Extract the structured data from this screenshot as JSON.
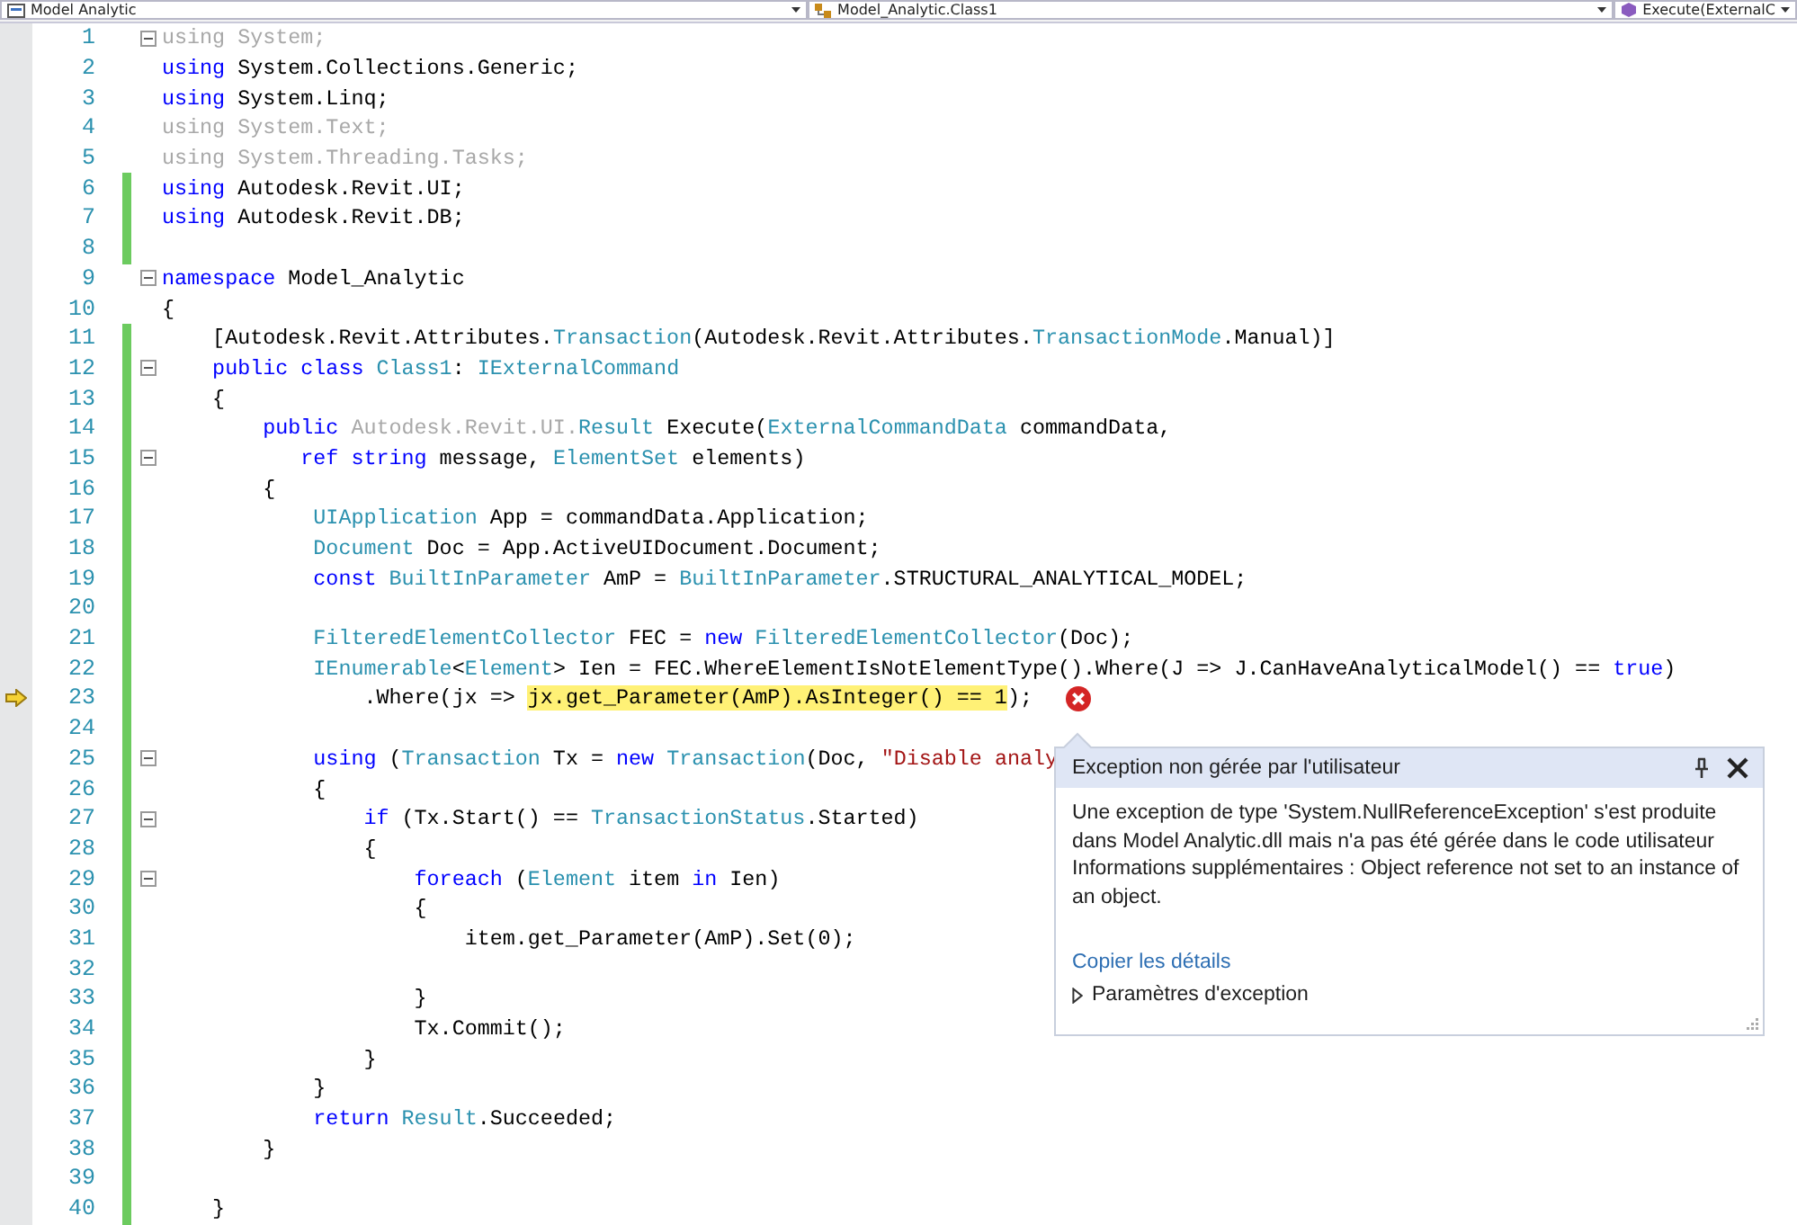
{
  "nav": [
    {
      "kind": "project",
      "label": "Model Analytic"
    },
    {
      "kind": "class",
      "label": "Model_Analytic.Class1"
    },
    {
      "kind": "method",
      "label": "Execute(ExternalC"
    }
  ],
  "lines": [
    {
      "n": "1",
      "changed": false,
      "fold": true,
      "current": false,
      "error": false,
      "tokens": [
        {
          "kind": "faded",
          "text": "using System;"
        }
      ]
    },
    {
      "n": "2",
      "changed": false,
      "fold": false,
      "current": false,
      "error": false,
      "tokens": [
        {
          "kind": "kw",
          "text": "using"
        },
        {
          "kind": "plain",
          "text": " System.Collections.Generic;"
        }
      ]
    },
    {
      "n": "3",
      "changed": false,
      "fold": false,
      "current": false,
      "error": false,
      "tokens": [
        {
          "kind": "kw",
          "text": "using"
        },
        {
          "kind": "plain",
          "text": " System.Linq;"
        }
      ]
    },
    {
      "n": "4",
      "changed": false,
      "fold": false,
      "current": false,
      "error": false,
      "tokens": [
        {
          "kind": "faded",
          "text": "using System.Text;"
        }
      ]
    },
    {
      "n": "5",
      "changed": false,
      "fold": false,
      "current": false,
      "error": false,
      "tokens": [
        {
          "kind": "faded",
          "text": "using System.Threading.Tasks;"
        }
      ]
    },
    {
      "n": "6",
      "changed": true,
      "fold": false,
      "current": false,
      "error": false,
      "tokens": [
        {
          "kind": "kw",
          "text": "using"
        },
        {
          "kind": "plain",
          "text": " Autodesk.Revit.UI;"
        }
      ]
    },
    {
      "n": "7",
      "changed": true,
      "fold": false,
      "current": false,
      "error": false,
      "tokens": [
        {
          "kind": "kw",
          "text": "using"
        },
        {
          "kind": "plain",
          "text": " Autodesk.Revit.DB;"
        }
      ]
    },
    {
      "n": "8",
      "changed": true,
      "fold": false,
      "current": false,
      "error": false
    },
    {
      "n": "9",
      "changed": false,
      "fold": true,
      "current": false,
      "error": false,
      "tokens": [
        {
          "kind": "kw",
          "text": "namespace"
        },
        {
          "kind": "plain",
          "text": " Model_Analytic"
        }
      ]
    },
    {
      "n": "10",
      "changed": false,
      "fold": false,
      "current": false,
      "error": false,
      "tokens": [
        {
          "kind": "plain",
          "text": "{"
        }
      ]
    },
    {
      "n": "11",
      "changed": true,
      "fold": false,
      "current": false,
      "error": false,
      "tokens": [
        {
          "kind": "plain",
          "text": "    [Autodesk.Revit.Attributes."
        },
        {
          "kind": "type",
          "text": "Transaction"
        },
        {
          "kind": "plain",
          "text": "(Autodesk.Revit.Attributes."
        },
        {
          "kind": "type",
          "text": "TransactionMode"
        },
        {
          "kind": "plain",
          "text": ".Manual)]"
        }
      ]
    },
    {
      "n": "12",
      "changed": true,
      "fold": true,
      "current": false,
      "error": false,
      "tokens": [
        {
          "kind": "kw",
          "text": "    public class "
        },
        {
          "kind": "type",
          "text": "Class1"
        },
        {
          "kind": "plain",
          "text": ": "
        },
        {
          "kind": "type",
          "text": "IExternalCommand"
        }
      ]
    },
    {
      "n": "13",
      "changed": true,
      "fold": false,
      "current": false,
      "error": false,
      "tokens": [
        {
          "kind": "plain",
          "text": "    {"
        }
      ]
    },
    {
      "n": "14",
      "changed": true,
      "fold": false,
      "current": false,
      "error": false,
      "tokens": [
        {
          "kind": "kw",
          "text": "        public "
        },
        {
          "kind": "faded",
          "text": "Autodesk.Revit.UI."
        },
        {
          "kind": "type",
          "text": "Result"
        },
        {
          "kind": "plain",
          "text": " Execute("
        },
        {
          "kind": "type",
          "text": "ExternalCommandData"
        },
        {
          "kind": "plain",
          "text": " commandData,"
        }
      ]
    },
    {
      "n": "15",
      "changed": true,
      "fold": true,
      "current": false,
      "error": false,
      "tokens": [
        {
          "kind": "kw",
          "text": "           ref string"
        },
        {
          "kind": "plain",
          "text": " message, "
        },
        {
          "kind": "type",
          "text": "ElementSet"
        },
        {
          "kind": "plain",
          "text": " elements)"
        }
      ]
    },
    {
      "n": "16",
      "changed": true,
      "fold": false,
      "current": false,
      "error": false,
      "tokens": [
        {
          "kind": "plain",
          "text": "        {"
        }
      ]
    },
    {
      "n": "17",
      "changed": true,
      "fold": false,
      "current": false,
      "error": false,
      "tokens": [
        {
          "kind": "type",
          "text": "            UIApplication"
        },
        {
          "kind": "plain",
          "text": " App = commandData.Application;"
        }
      ]
    },
    {
      "n": "18",
      "changed": true,
      "fold": false,
      "current": false,
      "error": false,
      "tokens": [
        {
          "kind": "type",
          "text": "            Document"
        },
        {
          "kind": "plain",
          "text": " Doc = App.ActiveUIDocument.Document;"
        }
      ]
    },
    {
      "n": "19",
      "changed": true,
      "fold": false,
      "current": false,
      "error": false,
      "tokens": [
        {
          "kind": "kw",
          "text": "            const "
        },
        {
          "kind": "type",
          "text": "BuiltInParameter"
        },
        {
          "kind": "plain",
          "text": " AmP = "
        },
        {
          "kind": "type",
          "text": "BuiltInParameter"
        },
        {
          "kind": "plain",
          "text": ".STRUCTURAL_ANALYTICAL_MODEL;"
        }
      ]
    },
    {
      "n": "20",
      "changed": true,
      "fold": false,
      "current": false,
      "error": false
    },
    {
      "n": "21",
      "changed": true,
      "fold": false,
      "current": false,
      "error": false,
      "tokens": [
        {
          "kind": "type",
          "text": "            FilteredElementCollector"
        },
        {
          "kind": "plain",
          "text": " FEC = "
        },
        {
          "kind": "kw",
          "text": "new "
        },
        {
          "kind": "type",
          "text": "FilteredElementCollector"
        },
        {
          "kind": "plain",
          "text": "(Doc);"
        }
      ]
    },
    {
      "n": "22",
      "changed": true,
      "fold": false,
      "current": false,
      "error": false,
      "tokens": [
        {
          "kind": "type",
          "text": "            IEnumerable"
        },
        {
          "kind": "plain",
          "text": "<"
        },
        {
          "kind": "type",
          "text": "Element"
        },
        {
          "kind": "plain",
          "text": "> Ien = FEC.WhereElementIsNotElementType().Where(J => J.CanHaveAnalyticalModel() == "
        },
        {
          "kind": "kw",
          "text": "true"
        },
        {
          "kind": "plain",
          "text": ")"
        }
      ]
    },
    {
      "n": "23",
      "changed": true,
      "fold": false,
      "current": true,
      "error": true,
      "tokens": [
        {
          "kind": "plain",
          "text": "                .Where(jx => "
        },
        {
          "kind": "hl",
          "text": "jx.get_Parameter(AmP).AsInteger() == 1"
        },
        {
          "kind": "plain",
          "text": ");"
        }
      ]
    },
    {
      "n": "24",
      "changed": true,
      "fold": false,
      "current": false,
      "error": false
    },
    {
      "n": "25",
      "changed": true,
      "fold": true,
      "current": false,
      "error": false,
      "tokens": [
        {
          "kind": "kw",
          "text": "            using"
        },
        {
          "kind": "plain",
          "text": " ("
        },
        {
          "kind": "type",
          "text": "Transaction"
        },
        {
          "kind": "plain",
          "text": " Tx = "
        },
        {
          "kind": "kw",
          "text": "new "
        },
        {
          "kind": "type",
          "text": "Transaction"
        },
        {
          "kind": "plain",
          "text": "(Doc, "
        },
        {
          "kind": "str",
          "text": "\"Disable analy"
        }
      ]
    },
    {
      "n": "26",
      "changed": true,
      "fold": false,
      "current": false,
      "error": false,
      "tokens": [
        {
          "kind": "plain",
          "text": "            {"
        }
      ]
    },
    {
      "n": "27",
      "changed": true,
      "fold": true,
      "current": false,
      "error": false,
      "tokens": [
        {
          "kind": "kw",
          "text": "                if"
        },
        {
          "kind": "plain",
          "text": " (Tx.Start() == "
        },
        {
          "kind": "type",
          "text": "TransactionStatus"
        },
        {
          "kind": "plain",
          "text": ".Started)"
        }
      ]
    },
    {
      "n": "28",
      "changed": true,
      "fold": false,
      "current": false,
      "error": false,
      "tokens": [
        {
          "kind": "plain",
          "text": "                {"
        }
      ]
    },
    {
      "n": "29",
      "changed": true,
      "fold": true,
      "current": false,
      "error": false,
      "tokens": [
        {
          "kind": "kw",
          "text": "                    foreach"
        },
        {
          "kind": "plain",
          "text": " ("
        },
        {
          "kind": "type",
          "text": "Element"
        },
        {
          "kind": "plain",
          "text": " item "
        },
        {
          "kind": "kw",
          "text": "in"
        },
        {
          "kind": "plain",
          "text": " Ien)"
        }
      ]
    },
    {
      "n": "30",
      "changed": true,
      "fold": false,
      "current": false,
      "error": false,
      "tokens": [
        {
          "kind": "plain",
          "text": "                    {"
        }
      ]
    },
    {
      "n": "31",
      "changed": true,
      "fold": false,
      "current": false,
      "error": false,
      "tokens": [
        {
          "kind": "plain",
          "text": "                        item.get_Parameter(AmP).Set(0);"
        }
      ]
    },
    {
      "n": "32",
      "changed": true,
      "fold": false,
      "current": false,
      "error": false
    },
    {
      "n": "33",
      "changed": true,
      "fold": false,
      "current": false,
      "error": false,
      "tokens": [
        {
          "kind": "plain",
          "text": "                    }"
        }
      ]
    },
    {
      "n": "34",
      "changed": true,
      "fold": false,
      "current": false,
      "error": false,
      "tokens": [
        {
          "kind": "plain",
          "text": "                    Tx.Commit();"
        }
      ]
    },
    {
      "n": "35",
      "changed": true,
      "fold": false,
      "current": false,
      "error": false,
      "tokens": [
        {
          "kind": "plain",
          "text": "                }"
        }
      ]
    },
    {
      "n": "36",
      "changed": true,
      "fold": false,
      "current": false,
      "error": false,
      "tokens": [
        {
          "kind": "plain",
          "text": "            }"
        }
      ]
    },
    {
      "n": "37",
      "changed": true,
      "fold": false,
      "current": false,
      "error": false,
      "tokens": [
        {
          "kind": "kw",
          "text": "            return "
        },
        {
          "kind": "type",
          "text": "Result"
        },
        {
          "kind": "plain",
          "text": ".Succeeded;"
        }
      ]
    },
    {
      "n": "38",
      "changed": true,
      "fold": false,
      "current": false,
      "error": false,
      "tokens": [
        {
          "kind": "plain",
          "text": "        }"
        }
      ]
    },
    {
      "n": "39",
      "changed": true,
      "fold": false,
      "current": false,
      "error": false
    },
    {
      "n": "40",
      "changed": true,
      "fold": false,
      "current": false,
      "error": false,
      "tokens": [
        {
          "kind": "plain",
          "text": "    }"
        }
      ]
    }
  ],
  "exception_popup": {
    "title": "Exception non gérée par l'utilisateur",
    "message": "Une exception de type 'System.NullReferenceException' s'est produite dans Model Analytic.dll mais n'a pas été gérée dans le code utilisateur Informations supplémentaires : Object reference not set to an instance of an object.",
    "link": "Copier les détails",
    "expander": {
      "label": "Paramètres d'exception",
      "expanded": false
    }
  }
}
